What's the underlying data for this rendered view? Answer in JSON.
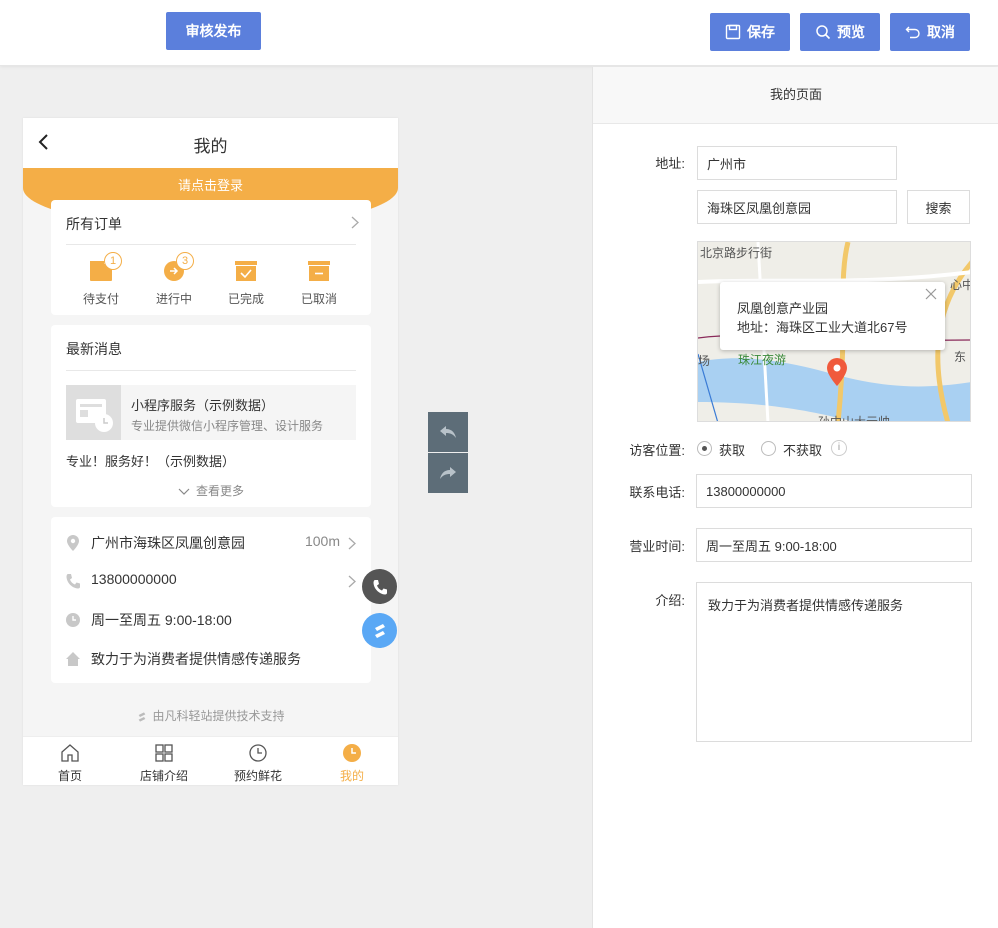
{
  "toolbar": {
    "publish_label": "审核发布",
    "save_label": "保存",
    "preview_label": "预览",
    "cancel_label": "取消"
  },
  "phone": {
    "title": "我的",
    "login_prompt": "请点击登录",
    "orders": {
      "title": "所有订单",
      "items": [
        {
          "label": "待支付",
          "icon": "wallet-icon",
          "badge": "1"
        },
        {
          "label": "进行中",
          "icon": "in-progress-icon",
          "badge": "3"
        },
        {
          "label": "已完成",
          "icon": "check-box-icon",
          "badge": ""
        },
        {
          "label": "已取消",
          "icon": "cancel-box-icon",
          "badge": ""
        }
      ]
    },
    "news": {
      "title": "最新消息",
      "item_title": "小程序服务（示例数据）",
      "item_desc": "专业提供微信小程序管理、设计服务",
      "text": "专业！服务好！（示例数据）",
      "see_more": "查看更多"
    },
    "info": {
      "address": "广州市海珠区凤凰创意园",
      "distance": "100m",
      "phone": "13800000000",
      "hours": "周一至周五 9:00-18:00",
      "intro": "致力于为消费者提供情感传递服务"
    },
    "support": "由凡科轻站提供技术支持",
    "tabs": [
      {
        "label": "首页",
        "icon": "home-icon"
      },
      {
        "label": "店铺介绍",
        "icon": "grid-icon"
      },
      {
        "label": "预约鲜花",
        "icon": "clock-icon"
      },
      {
        "label": "我的",
        "icon": "clock-filled-icon"
      }
    ],
    "accent_color": "#f4ae47"
  },
  "panel": {
    "title": "我的页面",
    "address_label": "地址:",
    "city": "广州市",
    "address_detail": "海珠区凤凰创意园",
    "search_label": "搜索",
    "map": {
      "popup_name": "凤凰创意产业园",
      "popup_address": "地址：海珠区工业大道北67号",
      "labels": [
        "北京路步行街",
        "心中",
        "珠江夜游",
        "东",
        "场",
        "孙中山大元帅"
      ]
    },
    "visitor_label": "访客位置:",
    "visitor_options": [
      "获取",
      "不获取"
    ],
    "visitor_selected": "获取",
    "visitor_hint": "i",
    "phone_label": "联系电话:",
    "phone_value": "13800000000",
    "hours_label": "营业时间:",
    "hours_value": "周一至周五 9:00-18:00",
    "intro_label": "介绍:",
    "intro_value": "致力于为消费者提供情感传递服务"
  },
  "colors": {
    "primary": "#5b7fdc",
    "accent": "#f4ae47"
  }
}
